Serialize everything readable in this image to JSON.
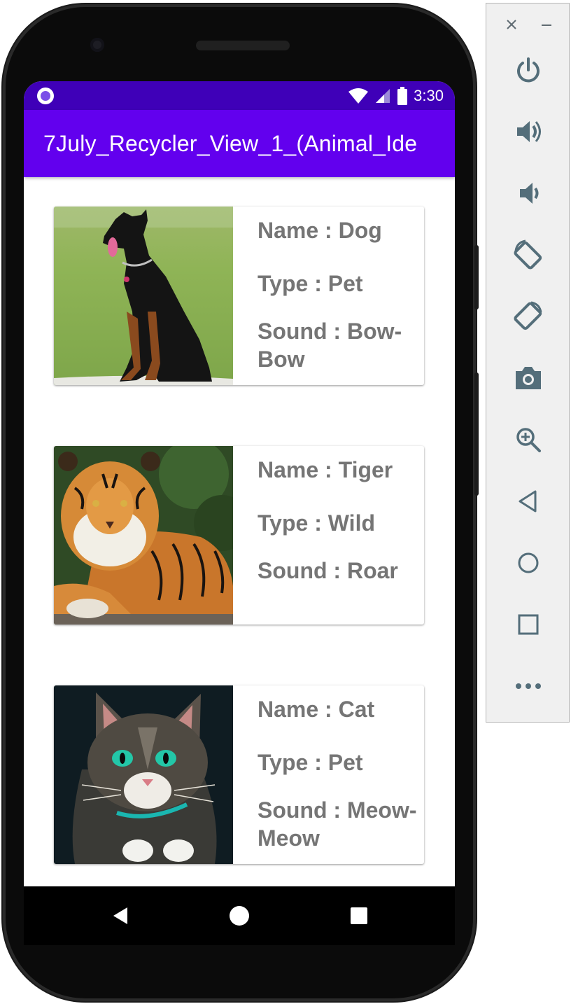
{
  "status_bar": {
    "time": "3:30"
  },
  "app_bar": {
    "title": "7July_Recycler_View_1_(Animal_Ide"
  },
  "animals": [
    {
      "name": "Name : Dog",
      "type": "Type : Pet",
      "sound": "Sound : Bow-Bow",
      "image": "doberman-dog-photo"
    },
    {
      "name": "Name : Tiger",
      "type": "Type : Wild",
      "sound": "Sound : Roar",
      "image": "tiger-photo"
    },
    {
      "name": "Name : Cat",
      "type": "Type : Pet",
      "sound": "Sound : Meow-Meow",
      "image": "tabby-cat-photo"
    }
  ],
  "nav_bar": {
    "icons": [
      "back-icon",
      "home-icon",
      "recents-icon"
    ]
  },
  "emulator_panel": {
    "icons": [
      "close-icon",
      "minimize-icon",
      "power-icon",
      "volume-up-icon",
      "volume-down-icon",
      "rotate-left-icon",
      "rotate-right-icon",
      "camera-icon",
      "zoom-icon",
      "back-icon",
      "home-icon",
      "overview-icon",
      "more-icon"
    ]
  },
  "colors": {
    "status_bar": "#3f00b8",
    "app_bar": "#6200ee",
    "card_text": "#757575",
    "emulator_icon": "#546e7a"
  }
}
